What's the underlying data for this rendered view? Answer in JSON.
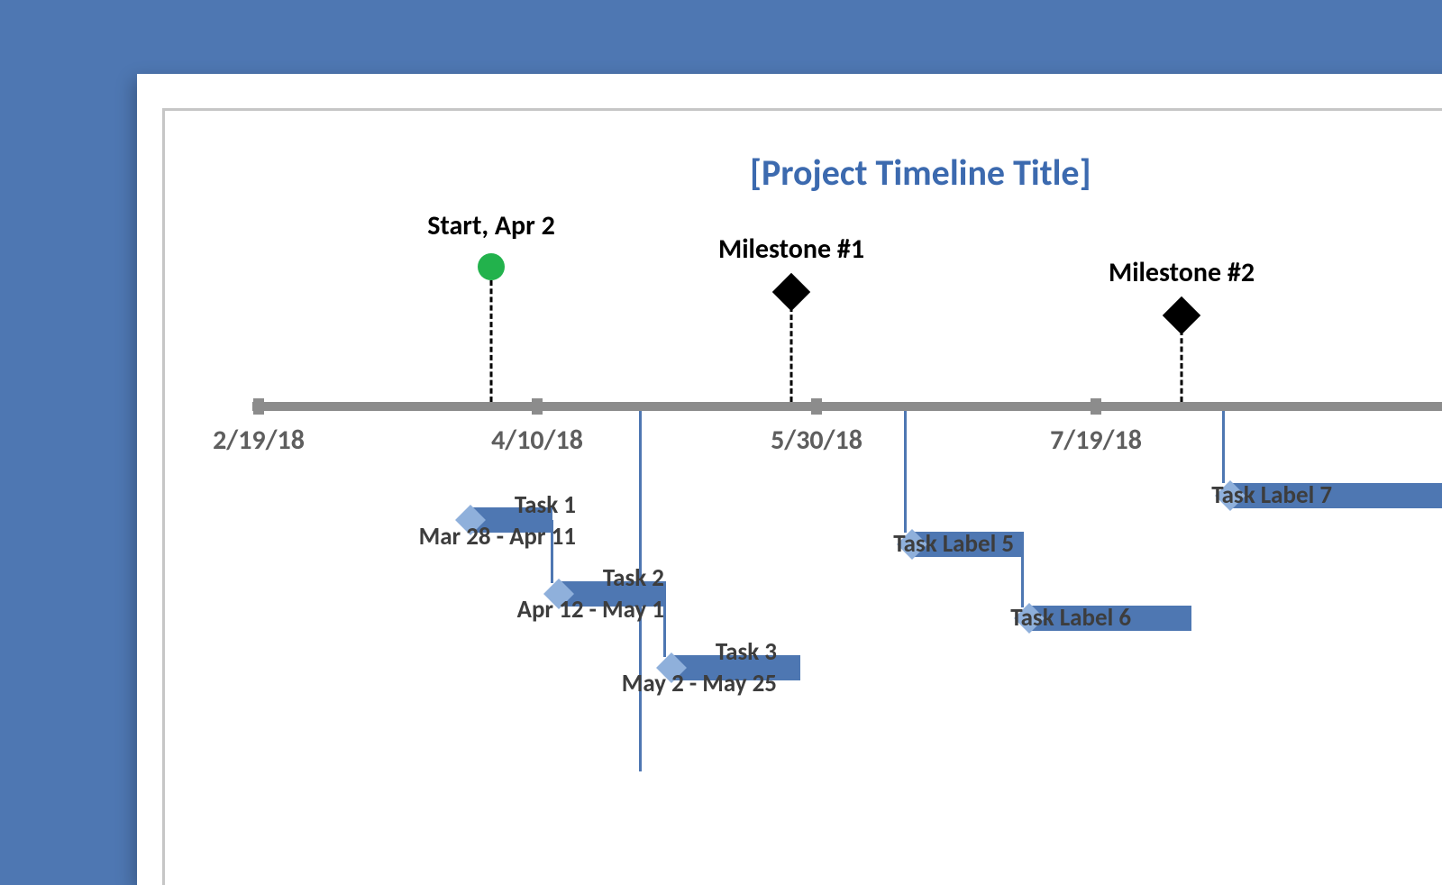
{
  "title": "[Project Timeline Title]",
  "axis": {
    "ticks": [
      "2/19/18",
      "4/10/18",
      "5/30/18",
      "7/19/18"
    ]
  },
  "milestones": {
    "start": {
      "label": "Start, Apr 2"
    },
    "m1": {
      "label": "Milestone #1"
    },
    "m2": {
      "label": "Milestone #2"
    }
  },
  "tasks": {
    "t1": {
      "name": "Task 1",
      "range": "Mar 28 - Apr 11"
    },
    "t2": {
      "name": "Task 2",
      "range": "Apr 12 - May 1"
    },
    "t3": {
      "name": "Task 3",
      "range": "May 2 - May 25"
    },
    "t5": {
      "name": "Task Label 5"
    },
    "t6": {
      "name": "Task Label 6"
    },
    "t7": {
      "name": "Task Label 7"
    }
  },
  "chart_data": {
    "type": "bar",
    "title": "[Project Timeline Title]",
    "xlabel": "",
    "ylabel": "",
    "x_ticks": [
      "2/19/18",
      "4/10/18",
      "5/30/18",
      "7/19/18"
    ],
    "milestones": [
      {
        "name": "Start",
        "date": "Apr 2",
        "marker": "circle",
        "color": "#22B24C"
      },
      {
        "name": "Milestone #1",
        "date": "5/30/18",
        "marker": "diamond",
        "color": "#000000"
      },
      {
        "name": "Milestone #2",
        "date": "7/19/18",
        "marker": "diamond",
        "color": "#000000"
      }
    ],
    "series": [
      {
        "name": "Task 1",
        "start": "Mar 28",
        "end": "Apr 11"
      },
      {
        "name": "Task 2",
        "start": "Apr 12",
        "end": "May 1"
      },
      {
        "name": "Task 3",
        "start": "May 2",
        "end": "May 25"
      },
      {
        "name": "Task Label 5",
        "start": "5/30/18",
        "end": "6/20/18"
      },
      {
        "name": "Task Label 6",
        "start": "6/20/18",
        "end": "7/19/18"
      },
      {
        "name": "Task Label 7",
        "start": "7/19/18",
        "end": "8/15/18"
      }
    ]
  }
}
